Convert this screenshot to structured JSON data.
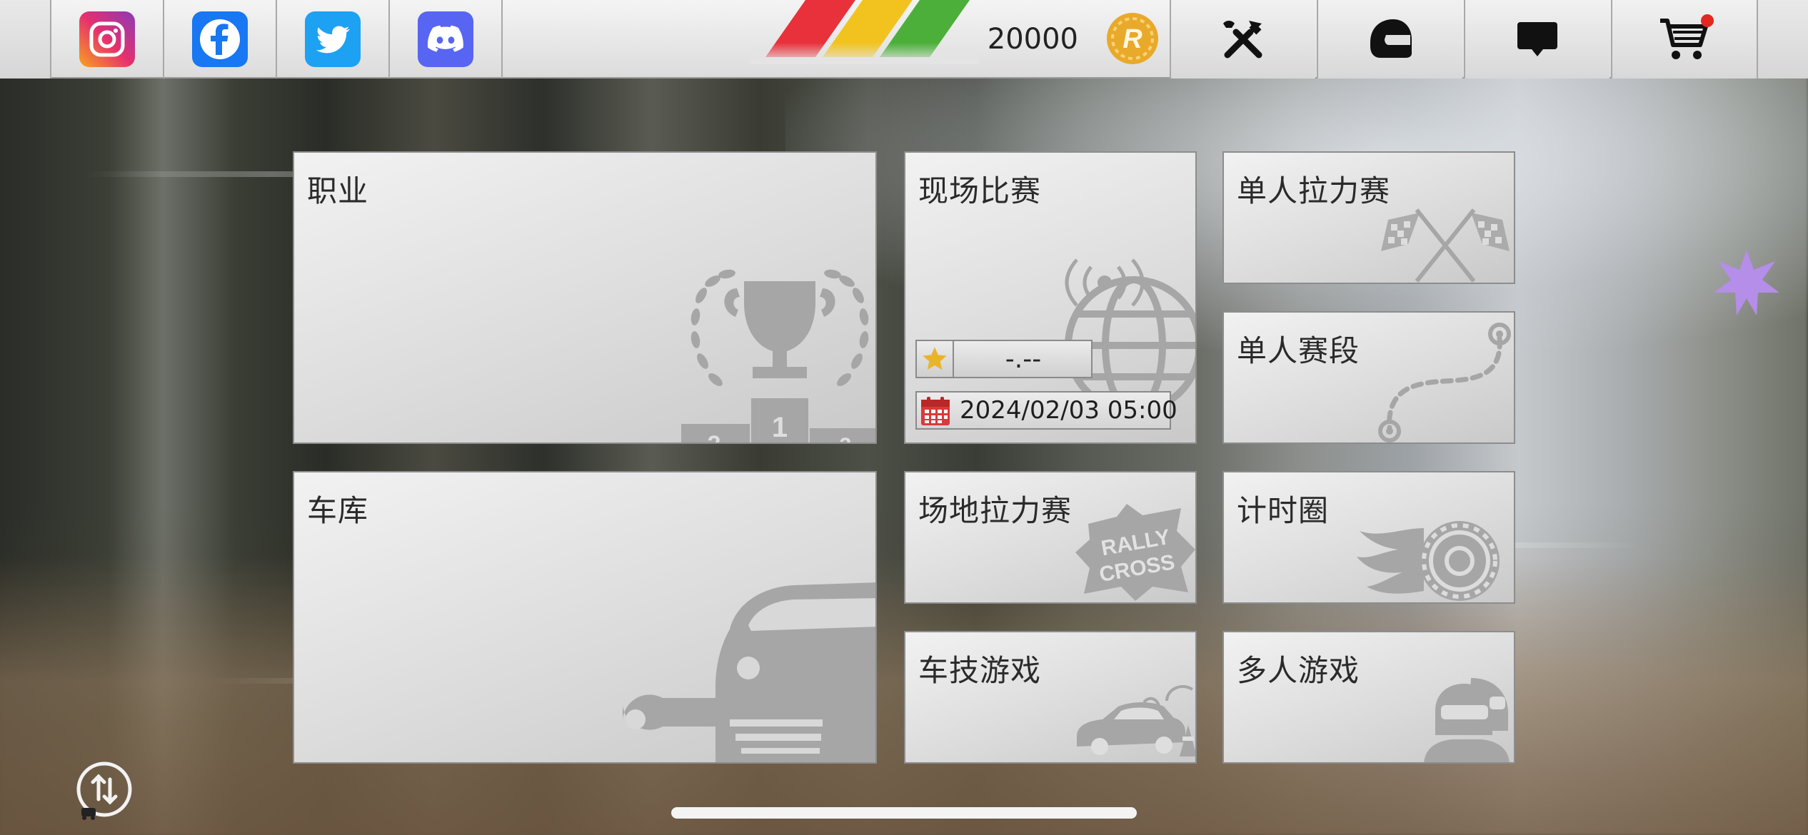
{
  "topbar": {
    "social": [
      {
        "name": "instagram",
        "icon": "instagram-icon",
        "color": "#e1306c"
      },
      {
        "name": "facebook",
        "icon": "facebook-icon",
        "color": "#1877f2"
      },
      {
        "name": "twitter",
        "icon": "twitter-icon",
        "color": "#1da1f2"
      },
      {
        "name": "discord",
        "icon": "discord-icon",
        "color": "#5865f2"
      }
    ],
    "coins": "20000",
    "coin_icon": "rally-coin-icon",
    "buttons": [
      {
        "name": "tools-button",
        "icon": "tools-icon"
      },
      {
        "name": "helmet-button",
        "icon": "helmet-icon"
      },
      {
        "name": "messages-button",
        "icon": "chat-icon"
      },
      {
        "name": "shop-button",
        "icon": "cart-icon",
        "notification": true
      }
    ],
    "stripe_colors": [
      "#e8313b",
      "#f2c31f",
      "#4caf3a"
    ]
  },
  "menu": {
    "career": {
      "label": "职业",
      "icon": "trophy-podium-icon"
    },
    "live_event": {
      "label": "现场比赛",
      "icon": "globe-broadcast-icon",
      "rank_value": "-.--",
      "rank_icon": "star-icon",
      "date": "2024/02/03 05:00",
      "date_icon": "calendar-icon"
    },
    "single_rally": {
      "label": "单人拉力赛",
      "icon": "checkered-flags-icon"
    },
    "single_stage": {
      "label": "单人赛段",
      "icon": "route-icon"
    },
    "garage": {
      "label": "车库",
      "icon": "car-wrench-icon"
    },
    "rallycross": {
      "label": "场地拉力赛",
      "icon": "rallycross-badge-icon",
      "badge_line1": "RALLY",
      "badge_line2": "CROSS"
    },
    "time_attack": {
      "label": "计时圈",
      "icon": "flaming-wheel-icon"
    },
    "gymkhana": {
      "label": "车技游戏",
      "icon": "drifting-car-icon"
    },
    "multiplayer": {
      "label": "多人游戏",
      "icon": "drivers-helmet-icon"
    }
  },
  "side": {
    "star_icon": "sparkle-star-icon",
    "star_color": "#b48ee8"
  },
  "bottom": {
    "swap_icon": "swap-arrows-icon"
  }
}
